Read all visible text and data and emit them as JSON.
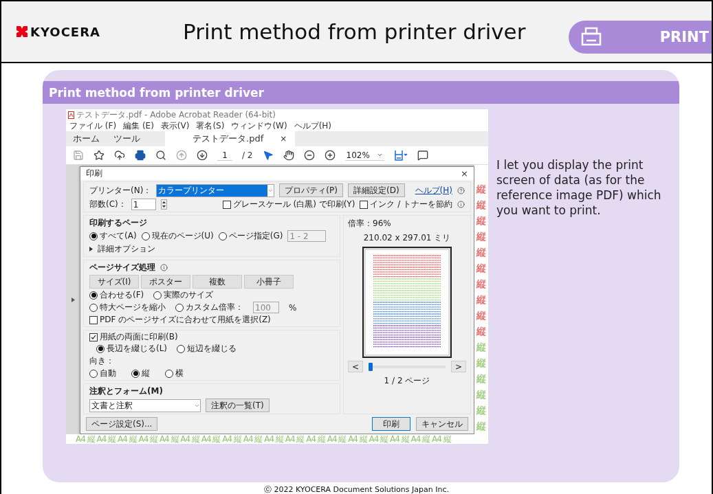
{
  "header": {
    "logo": "KYOCERA",
    "title": "Print method from printer driver",
    "badge": "PRINT"
  },
  "card": {
    "title": "Print method from printer driver",
    "description": "I let you display the print screen of data (as for the reference image PDF) which you want to print."
  },
  "app": {
    "window_title": "テストデータ.pdf - Adobe Acrobat Reader (64-bit)",
    "menu": [
      "ファイル (F)",
      "編集 (E)",
      "表示(V)",
      "署名(S)",
      "ウィンドウ(W)",
      "ヘルプ(H)"
    ],
    "tabs": [
      {
        "label": "ホーム",
        "selected": false
      },
      {
        "label": "ツール",
        "selected": false
      },
      {
        "label": "テストデータ.pdf",
        "selected": true
      }
    ],
    "tab_close": "×",
    "toolbar": {
      "page": "1",
      "page_total": "/ 2",
      "zoom": "102%"
    },
    "side_marks": [
      {
        "text": "縦",
        "color": "#e87070"
      },
      {
        "text": "縦",
        "color": "#e87070"
      },
      {
        "text": "縦",
        "color": "#e87070"
      },
      {
        "text": "縦",
        "color": "#e87070"
      },
      {
        "text": "縦",
        "color": "#e87070"
      },
      {
        "text": "縦",
        "color": "#e87070"
      },
      {
        "text": "縦",
        "color": "#e87070"
      },
      {
        "text": "縦",
        "color": "#e87070"
      },
      {
        "text": "縦",
        "color": "#e87070"
      },
      {
        "text": "縦",
        "color": "#e87070"
      },
      {
        "text": "縦",
        "color": "#9fcf7f"
      },
      {
        "text": "縦",
        "color": "#9fcf7f"
      },
      {
        "text": "縦",
        "color": "#9fcf7f"
      },
      {
        "text": "縦",
        "color": "#9fcf7f"
      },
      {
        "text": "縦",
        "color": "#9fcf7f"
      },
      {
        "text": "縦",
        "color": "#9fcf7f"
      }
    ],
    "bottom_line": "A4 縦 A4 縦 A4 縦 A4 縦 A4 縦 A4 縦 A4 縦 A4 縦 A4 縦 A4 縦 A4 縦 A4 縦 A4 縦 A4 縦 A4 縦 A4 縦 A4 縦 A4 縦"
  },
  "dialog": {
    "title": "印刷",
    "close": "×",
    "printer_label": "プリンター(N)：",
    "printer": "カラープリンター",
    "properties_button": "プロパティ(P)",
    "advanced_button": "詳細設定(D)",
    "help_link": "ヘルプ(H)",
    "copies_label": "部数(C)：",
    "copies": "1",
    "options": [
      {
        "label": "グレースケール (白黒) で印刷(Y)",
        "checked": false
      },
      {
        "label": "インク / トナーを節約",
        "checked": false
      }
    ],
    "pages": {
      "title": "印刷するページ",
      "choices": [
        {
          "label": "すべて(A)",
          "selected": true
        },
        {
          "label": "現在のページ(U)",
          "selected": false
        },
        {
          "label": "ページ指定(G)",
          "selected": false
        }
      ],
      "range": "1 - 2",
      "more": "詳細オプション"
    },
    "sizing": {
      "title": "ページサイズ処理",
      "modes": [
        "サイズ(I)",
        "ポスター",
        "複数",
        "小冊子"
      ],
      "fit": [
        {
          "label": "合わせる(F)",
          "selected": true
        },
        {
          "label": "実際のサイズ",
          "selected": false
        },
        {
          "label": "特大ページを縮小",
          "selected": false
        },
        {
          "label": "カスタム倍率：",
          "selected": false
        }
      ],
      "scale": "100",
      "percent": "%",
      "paper_option": {
        "label": "PDF のページサイズに合わせて用紙を選択(Z)",
        "checked": false
      }
    },
    "duplex": {
      "label": "用紙の両面に印刷(B)",
      "checked": true,
      "binding": [
        {
          "label": "長辺を綴じる(L)",
          "selected": true
        },
        {
          "label": "短辺を綴じる",
          "selected": false
        }
      ],
      "orientation_label": "向き：",
      "orientation": [
        {
          "label": "自動",
          "selected": false
        },
        {
          "label": "縦",
          "selected": true
        },
        {
          "label": "横",
          "selected": false
        }
      ]
    },
    "annotations": {
      "title": "注釈とフォーム(M)",
      "value": "文書と注釈",
      "summary_button": "注釈の一覧(T)"
    },
    "preview": {
      "scale": "倍率：96%",
      "size": "210.02 x 297.01 ミリ",
      "prev": "<",
      "next": ">",
      "slider": {
        "level": 0
      },
      "page": "1 / 2 ページ"
    },
    "page_setup_button": "ページ設定(S)...",
    "print_button": "印刷",
    "cancel_button": "キャンセル"
  },
  "footer": "ⓒ 2022 KYOCERA Document Solutions Japan Inc."
}
